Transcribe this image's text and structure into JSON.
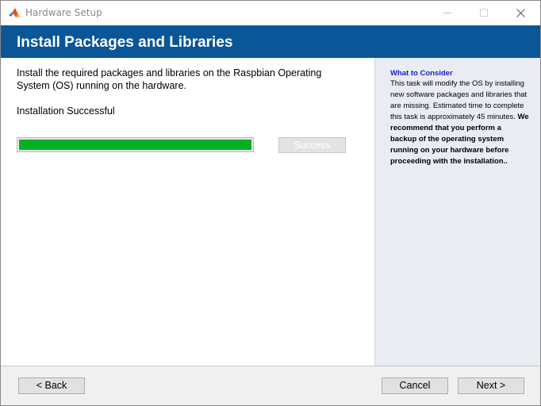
{
  "window": {
    "title": "Hardware Setup",
    "app_icon": "matlab-logo-icon",
    "controls": [
      "minimize-icon",
      "maximize-icon",
      "close-icon"
    ]
  },
  "header": {
    "title": "Install Packages and Libraries",
    "background_color": "#0a5697"
  },
  "main": {
    "description": "Install the required packages and libraries on the Raspbian Operating System (OS) running on the hardware.",
    "status": "Installation Successful",
    "progress": {
      "percent": 100,
      "fill_color": "#06b025"
    },
    "status_button_label": "Success"
  },
  "side_panel": {
    "heading": "What to Consider",
    "heading_color": "#1a1ad0",
    "body": "This task will modify the OS by installing new software packages and libraries that are missing. Estimated time to complete this task is approximately 45 minutes.",
    "recommendation": "We recommend that you perform a backup of the operating system running on your hardware before proceeding with the installation.."
  },
  "footer": {
    "back_label": "< Back",
    "cancel_label": "Cancel",
    "next_label": "Next >"
  }
}
